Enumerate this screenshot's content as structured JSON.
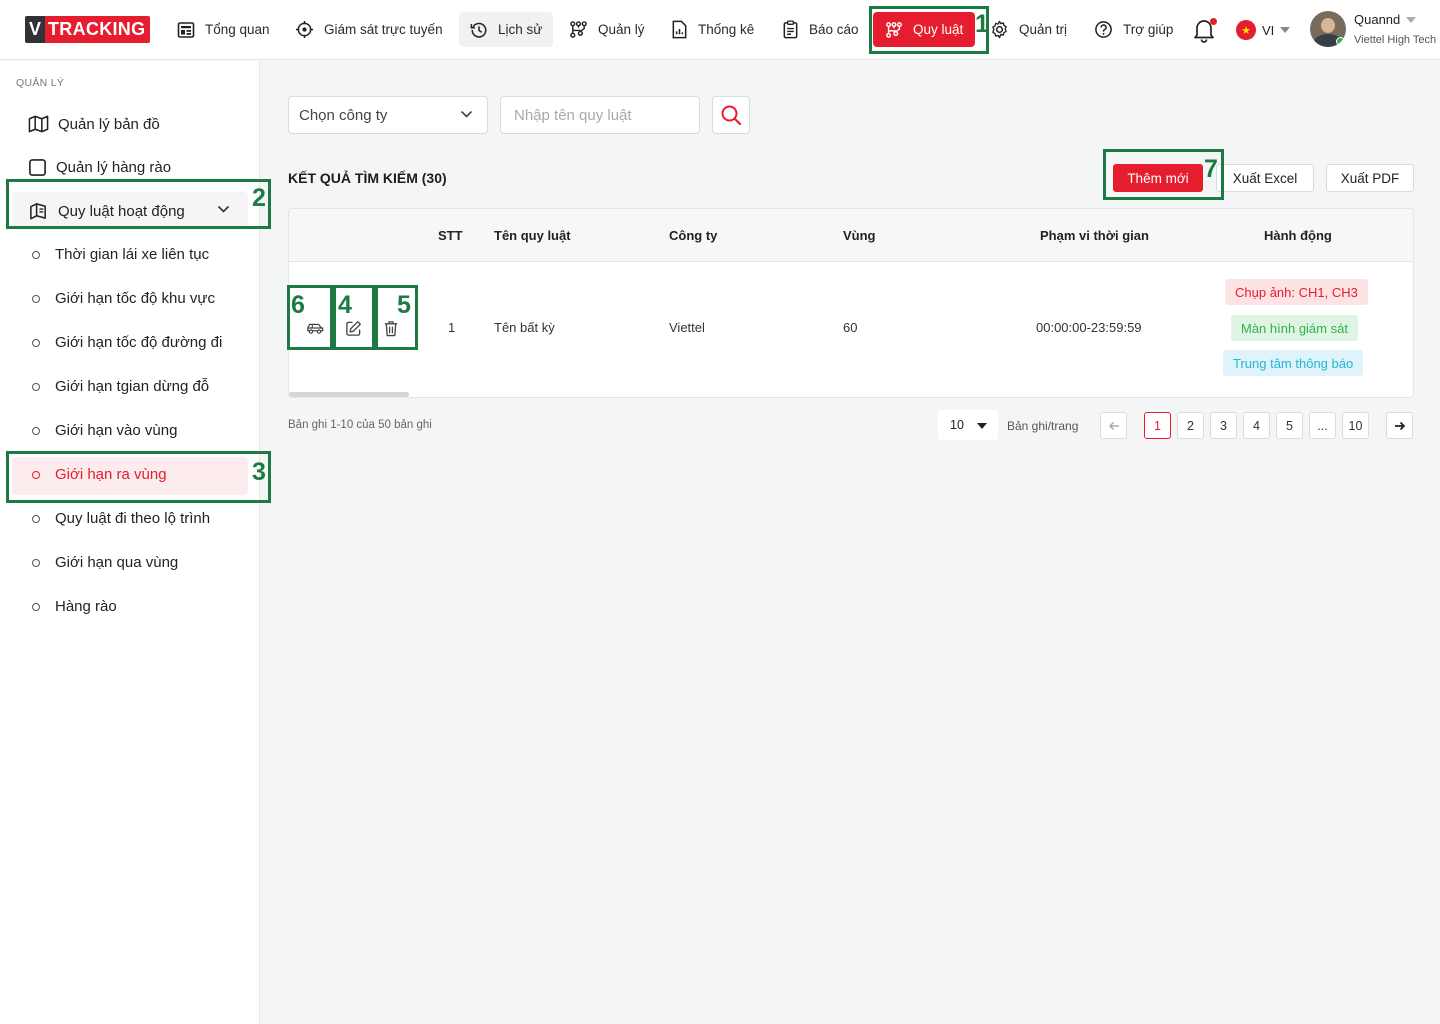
{
  "header": {
    "logo_v": "V",
    "logo_text": "TRACKING",
    "nav": {
      "overview": "Tổng quan",
      "monitoring": "Giám sát trực tuyến",
      "history": "Lịch sử",
      "manage": "Quản lý",
      "statistics": "Thống kê",
      "reports": "Báo cáo",
      "rules": "Quy luật",
      "admin": "Quản trị",
      "help": "Trợ giúp"
    },
    "language": "VI",
    "user_name": "Quannd",
    "user_company": "Viettel High Tech",
    "accent_color": "#e51d2e"
  },
  "sidebar": {
    "section": "QUẢN LÝ",
    "map_management": "Quản lý bản đồ",
    "fence_management": "Quản lý hàng rào",
    "activity_rules": "Quy luật hoạt động",
    "sub_items": [
      "Thời gian lái xe liên tục",
      "Giới hạn tốc độ khu vực",
      "Giới hạn tốc độ đường đi",
      "Giới hạn tgian dừng đỗ",
      "Giới hạn vào vùng",
      "Giới hạn ra vùng",
      "Quy luật đi theo lộ trình",
      "Giới hạn qua vùng",
      "Hàng rào"
    ],
    "active_sub_item": "Giới hạn ra vùng"
  },
  "filters": {
    "company_select": "Chọn công ty",
    "rule_name_placeholder": "Nhập tên quy luật"
  },
  "results": {
    "title": "KẾT QUẢ TÌM KIẾM (30)",
    "add_new": "Thêm mới",
    "export_excel": "Xuất Excel",
    "export_pdf": "Xuất PDF"
  },
  "table": {
    "columns": [
      "STT",
      "Tên quy luật",
      "Công ty",
      "Vùng",
      "Phạm vi thời gian",
      "Hành động"
    ],
    "rows": [
      {
        "stt": "1",
        "name": "Tên bất kỳ",
        "company": "Viettel",
        "zone": "60",
        "time_range": "00:00:00-23:59:59",
        "actions": [
          "Chụp ảnh: CH1, CH3",
          "Màn hình giám sát",
          "Trung tâm thông báo"
        ]
      }
    ]
  },
  "pagination": {
    "records_info": "Bản ghi 1-10 của 50 bản ghi",
    "per_page": "10",
    "per_page_label": "Bản ghi/trang",
    "pages": [
      "1",
      "2",
      "3",
      "4",
      "5",
      "...",
      "10"
    ],
    "current_page": "1"
  },
  "annotations": [
    "1",
    "2",
    "3",
    "4",
    "5",
    "6",
    "7"
  ]
}
